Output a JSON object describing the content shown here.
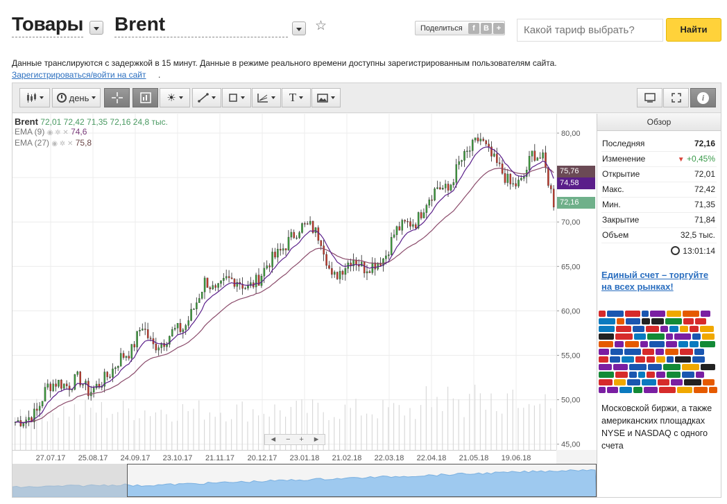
{
  "header": {
    "section_title": "Товары",
    "instrument": "Brent",
    "share_label": "Поделиться",
    "share_icons": [
      "f",
      "B",
      "+"
    ],
    "search_placeholder": "Какой тариф выбрать?",
    "search_button": "Найти"
  },
  "notice": {
    "text": "Данные транслируются с задержкой в 15 минут. Данные в режиме реального времени доступны зарегистрированным пользователям сайта.",
    "link": "Зарегистрироваться/войти на сайт",
    "link_suffix": "."
  },
  "toolbar": {
    "period_label": "день",
    "icons": [
      "candles-icon",
      "clock-icon",
      "crosshair-icon",
      "zoom-icon",
      "indicators-icon",
      "line-tool-icon",
      "shape-tool-icon",
      "fibonacci-icon",
      "text-tool-icon",
      "image-icon",
      "screenshot-icon",
      "fullscreen-icon",
      "info-icon"
    ]
  },
  "legend": {
    "symbol": "Brent",
    "open": "72,01",
    "high": "72,42",
    "low": "71,35",
    "close": "72,16",
    "volume": "24,8 тыс.",
    "ema1_label": "EMA (9)",
    "ema1_value": "74,6",
    "ema2_label": "EMA (27)",
    "ema2_value": "75,8"
  },
  "price_tags": [
    {
      "value": "75,76",
      "color": "#6b4a55"
    },
    {
      "value": "74,58",
      "color": "#5a1e8a"
    },
    {
      "value": "72,16",
      "color": "#6fb08a"
    }
  ],
  "side": {
    "title": "Обзор",
    "rows": [
      {
        "key": "Последняя",
        "value": "72,16"
      },
      {
        "key": "Изменение",
        "value": "+0,45%"
      },
      {
        "key": "Открытие",
        "value": "72,01"
      },
      {
        "key": "Макс.",
        "value": "72,42"
      },
      {
        "key": "Мин.",
        "value": "71,35"
      },
      {
        "key": "Закрытие",
        "value": "71,84"
      },
      {
        "key": "Объем",
        "value": "32,5 тыс."
      }
    ],
    "time": "13:01:14",
    "promo_link": "Единый счет – торгуйте на всех рынках!",
    "promo_text": "Московской биржи, а также американских площадках NYSE и NASDAQ с одного счета"
  },
  "scroller": [
    "◄",
    "−",
    "+",
    "►"
  ],
  "chart_data": {
    "type": "candlestick",
    "y_ticks": [
      "80,00",
      "75,00",
      "70,00",
      "65,00",
      "60,00",
      "55,00",
      "50,00",
      "45,00"
    ],
    "x_ticks": [
      "27.07.17",
      "25.08.17",
      "24.09.17",
      "23.10.17",
      "21.11.17",
      "20.12.17",
      "23.01.18",
      "21.02.18",
      "22.03.18",
      "22.04.18",
      "21.05.18",
      "19.06.18"
    ],
    "ylim": [
      44,
      82
    ],
    "close_path": {
      "x": [
        "2017-06-27",
        "2017-07-05",
        "2017-07-12",
        "2017-07-20",
        "2017-07-27",
        "2017-08-03",
        "2017-08-10",
        "2017-08-17",
        "2017-08-25",
        "2017-09-01",
        "2017-09-08",
        "2017-09-15",
        "2017-09-24",
        "2017-10-01",
        "2017-10-08",
        "2017-10-15",
        "2017-10-23",
        "2017-10-30",
        "2017-11-07",
        "2017-11-14",
        "2017-11-21",
        "2017-11-28",
        "2017-12-06",
        "2017-12-13",
        "2017-12-20",
        "2017-12-27",
        "2018-01-04",
        "2018-01-12",
        "2018-01-23",
        "2018-01-30",
        "2018-02-07",
        "2018-02-14",
        "2018-02-21",
        "2018-02-28",
        "2018-03-08",
        "2018-03-15",
        "2018-03-22",
        "2018-03-29",
        "2018-04-06",
        "2018-04-13",
        "2018-04-22",
        "2018-04-29",
        "2018-05-07",
        "2018-05-14",
        "2018-05-21",
        "2018-05-28",
        "2018-06-05",
        "2018-06-12",
        "2018-06-19",
        "2018-06-26",
        "2018-07-03",
        "2018-07-10"
      ],
      "y": [
        47.5,
        47.8,
        48.5,
        51.5,
        52.0,
        51.5,
        52.5,
        50.8,
        51.8,
        53.0,
        54.8,
        55.5,
        58.5,
        56.0,
        56.5,
        57.8,
        58.0,
        60.5,
        63.5,
        62.0,
        63.5,
        63.5,
        62.5,
        63.5,
        65.5,
        66.5,
        68.0,
        69.5,
        69.5,
        68.0,
        63.5,
        64.8,
        66.0,
        64.8,
        65.3,
        66.0,
        69.0,
        69.8,
        70.0,
        72.5,
        74.0,
        73.5,
        76.5,
        78.0,
        79.5,
        77.5,
        75.8,
        74.0,
        74.5,
        77.8,
        77.0,
        72.2
      ]
    },
    "ema9_last": 74.6,
    "ema27_last": 75.8,
    "last_close": 72.16
  }
}
